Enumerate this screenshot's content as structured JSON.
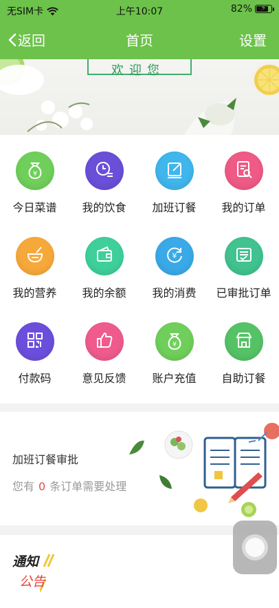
{
  "status_bar": {
    "carrier": "无SIM卡",
    "time": "上午10:07",
    "battery_percent": "82%",
    "battery_level": 0.82,
    "wifi_icon": "wifi-icon",
    "charging_icon": "bolt-icon"
  },
  "nav": {
    "back_label": "返回",
    "title": "首页",
    "settings_label": "设置",
    "color": "#6cc24a"
  },
  "banner": {
    "welcome_text": "欢迎您"
  },
  "grid": [
    {
      "label": "今日菜谱",
      "icon": "money-bag-icon",
      "color": "#6fcf5a"
    },
    {
      "label": "我的饮食",
      "icon": "clock-list-icon",
      "color": "#6a4fd8"
    },
    {
      "label": "加班订餐",
      "icon": "edit-icon",
      "color": "#3fb6ec"
    },
    {
      "label": "我的订单",
      "icon": "document-search-icon",
      "color": "#ef5a86"
    },
    {
      "label": "我的营养",
      "icon": "bowl-icon",
      "color": "#f6a93a"
    },
    {
      "label": "我的余额",
      "icon": "wallet-icon",
      "color": "#3fcf9a"
    },
    {
      "label": "我的消费",
      "icon": "yen-refresh-icon",
      "color": "#3aa9e8"
    },
    {
      "label": "已审批订单",
      "icon": "approved-list-icon",
      "color": "#41c28f"
    },
    {
      "label": "付款码",
      "icon": "qr-code-icon",
      "color": "#6b4fdc"
    },
    {
      "label": "意见反馈",
      "icon": "thumbs-up-icon",
      "color": "#ef5b8c"
    },
    {
      "label": "账户充值",
      "icon": "money-bag-icon",
      "color": "#6fcf5a"
    },
    {
      "label": "自助订餐",
      "icon": "shop-icon",
      "color": "#55c266"
    }
  ],
  "approval": {
    "title": "加班订餐审批",
    "desc_prefix": "您有",
    "count": "0",
    "desc_suffix": "条订单需要处理",
    "count_color": "#e34b4b"
  },
  "notice": {
    "line1": "通知",
    "line2": "公告"
  }
}
